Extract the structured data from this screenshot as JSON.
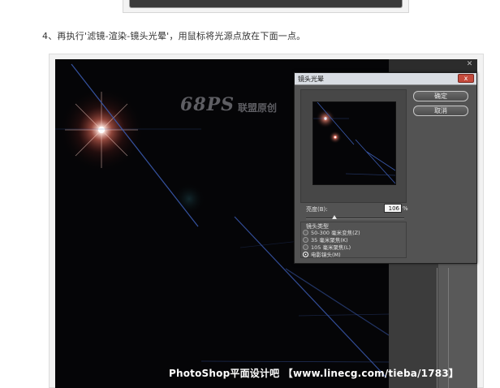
{
  "instruction_text": "4、再执行'滤镜-渲染-镜头光晕'，用鼠标将光源点放在下面一点。",
  "watermark": {
    "logo": "68PS",
    "subtitle": "联盟原创"
  },
  "footer_caption": "PhotoShop平面设计吧 【www.linecg.com/tieba/1783】",
  "dialog": {
    "title": "镜头光晕",
    "close_label": "x",
    "ok_label": "确定",
    "cancel_label": "取消",
    "brightness_label": "亮度(B):",
    "brightness_value": "106",
    "brightness_unit": "%",
    "brightness_percent": 106,
    "lens_type_label": "镜头类型",
    "lens_options": [
      {
        "label": "50-300 毫米变焦(Z)",
        "checked": false
      },
      {
        "label": "35 毫米聚焦(K)",
        "checked": false
      },
      {
        "label": "105 毫米聚焦(L)",
        "checked": false
      },
      {
        "label": "电影镜头(M)",
        "checked": true
      }
    ]
  },
  "colors": {
    "page_bg": "#ffffff",
    "canvas_bg": "#050507",
    "dialog_bg": "#535353",
    "flare_color": "#ff6b5a",
    "line_color": "#3b5bb0"
  }
}
